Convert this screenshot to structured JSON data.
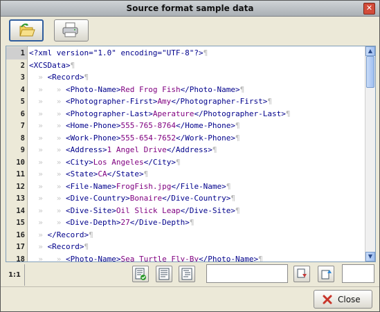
{
  "window": {
    "title": "Source format sample data"
  },
  "toolbar": {
    "open_icon": "folder-open-icon",
    "print_icon": "printer-icon"
  },
  "editor": {
    "current_line": 1,
    "lines": [
      [
        [
          "tag",
          "<?xml version=\"1.0\" encoding=\"UTF-8\"?>"
        ],
        [
          "eol",
          "¶"
        ]
      ],
      [
        [
          "tag",
          "<XCSData>"
        ],
        [
          "eol",
          "¶"
        ]
      ],
      [
        [
          "ws",
          "  » "
        ],
        [
          "tag",
          "<Record>"
        ],
        [
          "eol",
          "¶"
        ]
      ],
      [
        [
          "ws",
          "  »   » "
        ],
        [
          "tag",
          "<Photo-Name>"
        ],
        [
          "val",
          "Red Frog Fish"
        ],
        [
          "tag",
          "</Photo-Name>"
        ],
        [
          "eol",
          "¶"
        ]
      ],
      [
        [
          "ws",
          "  »   » "
        ],
        [
          "tag",
          "<Photographer-First>"
        ],
        [
          "val",
          "Amy"
        ],
        [
          "tag",
          "</Photographer-First>"
        ],
        [
          "eol",
          "¶"
        ]
      ],
      [
        [
          "ws",
          "  »   » "
        ],
        [
          "tag",
          "<Photographer-Last>"
        ],
        [
          "val",
          "Aperature"
        ],
        [
          "tag",
          "</Photographer-Last>"
        ],
        [
          "eol",
          "¶"
        ]
      ],
      [
        [
          "ws",
          "  »   » "
        ],
        [
          "tag",
          "<Home-Phone>"
        ],
        [
          "val",
          "555-765-8764"
        ],
        [
          "tag",
          "</Home-Phone>"
        ],
        [
          "eol",
          "¶"
        ]
      ],
      [
        [
          "ws",
          "  »   » "
        ],
        [
          "tag",
          "<Work-Phone>"
        ],
        [
          "val",
          "555-654-7652"
        ],
        [
          "tag",
          "</Work-Phone>"
        ],
        [
          "eol",
          "¶"
        ]
      ],
      [
        [
          "ws",
          "  »   » "
        ],
        [
          "tag",
          "<Address>"
        ],
        [
          "val",
          "1 Angel Drive"
        ],
        [
          "tag",
          "</Address>"
        ],
        [
          "eol",
          "¶"
        ]
      ],
      [
        [
          "ws",
          "  »   » "
        ],
        [
          "tag",
          "<City>"
        ],
        [
          "val",
          "Los Angeles"
        ],
        [
          "tag",
          "</City>"
        ],
        [
          "eol",
          "¶"
        ]
      ],
      [
        [
          "ws",
          "  »   » "
        ],
        [
          "tag",
          "<State>"
        ],
        [
          "val",
          "CA"
        ],
        [
          "tag",
          "</State>"
        ],
        [
          "eol",
          "¶"
        ]
      ],
      [
        [
          "ws",
          "  »   » "
        ],
        [
          "tag",
          "<File-Name>"
        ],
        [
          "val",
          "FrogFish.jpg"
        ],
        [
          "tag",
          "</File-Name>"
        ],
        [
          "eol",
          "¶"
        ]
      ],
      [
        [
          "ws",
          "  »   » "
        ],
        [
          "tag",
          "<Dive-Country>"
        ],
        [
          "val",
          "Bonaire"
        ],
        [
          "tag",
          "</Dive-Country>"
        ],
        [
          "eol",
          "¶"
        ]
      ],
      [
        [
          "ws",
          "  »   » "
        ],
        [
          "tag",
          "<Dive-Site>"
        ],
        [
          "val",
          "Oil Slick Leap"
        ],
        [
          "tag",
          "</Dive-Site>"
        ],
        [
          "eol",
          "¶"
        ]
      ],
      [
        [
          "ws",
          "  »   » "
        ],
        [
          "tag",
          "<Dive-Depth>"
        ],
        [
          "val",
          "27"
        ],
        [
          "tag",
          "</Dive-Depth>"
        ],
        [
          "eol",
          "¶"
        ]
      ],
      [
        [
          "ws",
          "  » "
        ],
        [
          "tag",
          "</Record>"
        ],
        [
          "eol",
          "¶"
        ]
      ],
      [
        [
          "ws",
          "  » "
        ],
        [
          "tag",
          "<Record>"
        ],
        [
          "eol",
          "¶"
        ]
      ],
      [
        [
          "ws",
          "  »   » "
        ],
        [
          "tag",
          "<Photo-Name>"
        ],
        [
          "val",
          "Sea Turtle Fly-By"
        ],
        [
          "tag",
          "</Photo-Name>"
        ],
        [
          "eol",
          "¶"
        ]
      ]
    ]
  },
  "status": {
    "position": "1:1",
    "search_value": "",
    "page_value": ""
  },
  "footer": {
    "close_label": "Close"
  },
  "colors": {
    "tag": "#00008b",
    "value": "#800080",
    "whitespace": "#c6c6c6"
  }
}
